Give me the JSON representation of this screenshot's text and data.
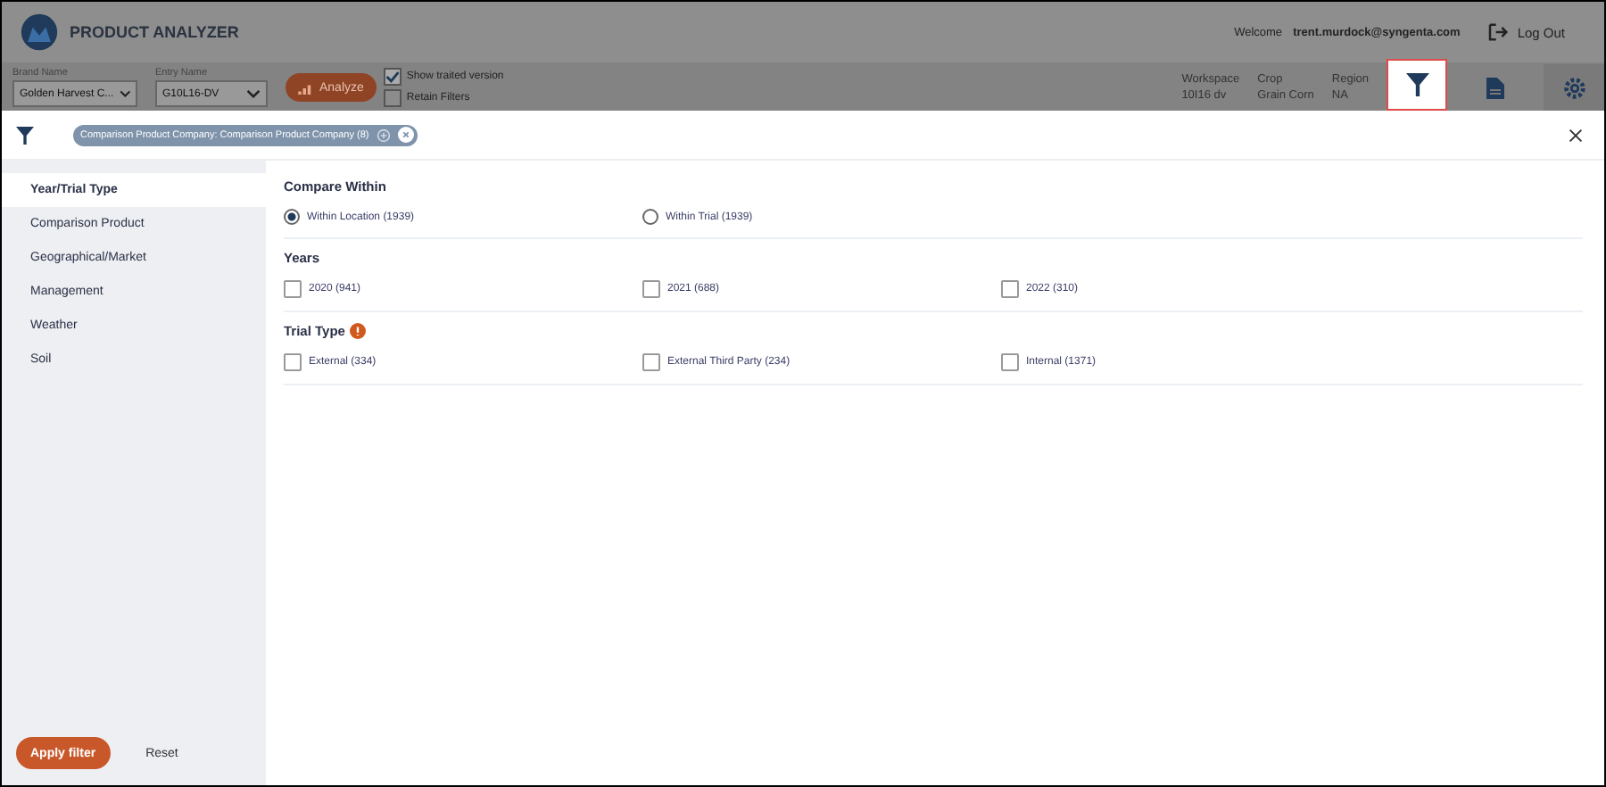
{
  "header": {
    "app_title": "PRODUCT ANALYZER",
    "welcome": "Welcome",
    "user": "trent.murdock@syngenta.com",
    "logout": "Log Out"
  },
  "toolbar": {
    "brand": {
      "label": "Brand Name",
      "value": "Golden Harvest C..."
    },
    "entry": {
      "label": "Entry Name",
      "value": "G10L16-DV"
    },
    "analyze": "Analyze",
    "options": [
      {
        "label": "Show traited version",
        "checked": true
      },
      {
        "label": "Retain Filters",
        "checked": false
      }
    ],
    "info": [
      {
        "label": "Workspace",
        "value": "10I16 dv"
      },
      {
        "label": "Crop",
        "value": "Grain Corn"
      },
      {
        "label": "Region",
        "value": "NA"
      }
    ],
    "tabs": [
      {
        "kind": "filter",
        "selected": true
      },
      {
        "kind": "report",
        "selected": false
      },
      {
        "kind": "settings",
        "selected": false
      }
    ]
  },
  "chips": [
    {
      "text": "Comparison Product Company: Comparison Product Company (8)"
    }
  ],
  "sidebar": {
    "items": [
      {
        "label": "Year/Trial Type",
        "selected": true
      },
      {
        "label": "Comparison Product",
        "selected": false
      },
      {
        "label": "Geographical/Market",
        "selected": false
      },
      {
        "label": "Management",
        "selected": false
      },
      {
        "label": "Weather",
        "selected": false
      },
      {
        "label": "Soil",
        "selected": false
      }
    ],
    "apply": "Apply filter",
    "reset": "Reset"
  },
  "sections": [
    {
      "title": "Compare Within",
      "kind": "radio",
      "info": false,
      "options": [
        {
          "label": "Within Location (1939)",
          "selected": true
        },
        {
          "label": "Within Trial (1939)",
          "selected": false
        }
      ]
    },
    {
      "title": "Years",
      "kind": "checkbox",
      "info": false,
      "options": [
        {
          "label": "2020 (941)",
          "checked": false
        },
        {
          "label": "2021 (688)",
          "checked": false
        },
        {
          "label": "2022 (310)",
          "checked": false
        }
      ]
    },
    {
      "title": "Trial Type",
      "kind": "checkbox",
      "info": true,
      "options": [
        {
          "label": "External (334)",
          "checked": false
        },
        {
          "label": "External Third Party (234)",
          "checked": false
        },
        {
          "label": "Internal (1371)",
          "checked": false
        }
      ]
    }
  ]
}
